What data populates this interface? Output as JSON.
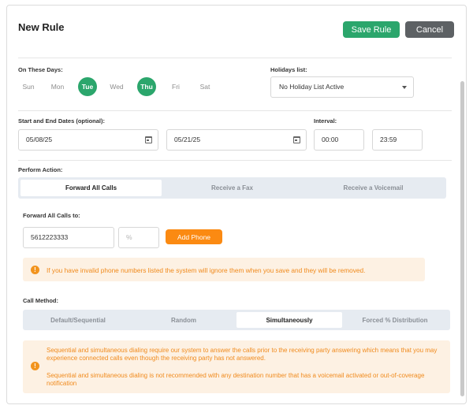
{
  "header": {
    "title": "New Rule",
    "save_label": "Save Rule",
    "cancel_label": "Cancel"
  },
  "schedule": {
    "days_label": "On These Days:",
    "days": [
      {
        "label": "Sun",
        "active": false
      },
      {
        "label": "Mon",
        "active": false
      },
      {
        "label": "Tue",
        "active": true
      },
      {
        "label": "Wed",
        "active": false
      },
      {
        "label": "Thu",
        "active": true
      },
      {
        "label": "Fri",
        "active": false
      },
      {
        "label": "Sat",
        "active": false
      }
    ],
    "holidays_label": "Holidays list:",
    "holidays_value": "No Holiday List Active",
    "dates_label": "Start and End Dates (optional):",
    "start_date": "05/08/25",
    "end_date": "05/21/25",
    "interval_label": "Interval:",
    "interval_start": "00:00",
    "interval_end": "23:59"
  },
  "action": {
    "label": "Perform Action:",
    "tabs": [
      "Forward All Calls",
      "Receive a Fax",
      "Receive a Voicemail"
    ],
    "active_tab": "Forward All Calls",
    "forward_label": "Forward All Calls to:",
    "phone_value": "5612223333",
    "percent_placeholder": "%",
    "add_phone_label": "Add Phone",
    "invalid_warning": "If you have invalid phone numbers listed the system will ignore them when you save and they will be removed."
  },
  "call_method": {
    "label": "Call Method:",
    "options": [
      "Default/Sequential",
      "Random",
      "Simultaneously",
      "Forced % Distribution"
    ],
    "active": "Simultaneously",
    "info_1": "Sequential and simultaneous dialing require our system to answer the calls prior to the receiving party answering which means that you may experience connected calls even though the receiving party has not answered.",
    "info_2": "Sequential and simultaneous dialing is not recommended with any destination number that has a voicemail activated or out-of-coverage notification"
  },
  "colors": {
    "accent_green": "#2ba66c",
    "cancel_gray": "#5d6164",
    "add_orange": "#fb8a12",
    "warning_bg": "#fdf1e3",
    "warning_text": "#f08a1c"
  },
  "icons": {
    "calendar": "calendar-icon",
    "dropdown": "chevron-down-icon",
    "warning": "warning-icon"
  }
}
